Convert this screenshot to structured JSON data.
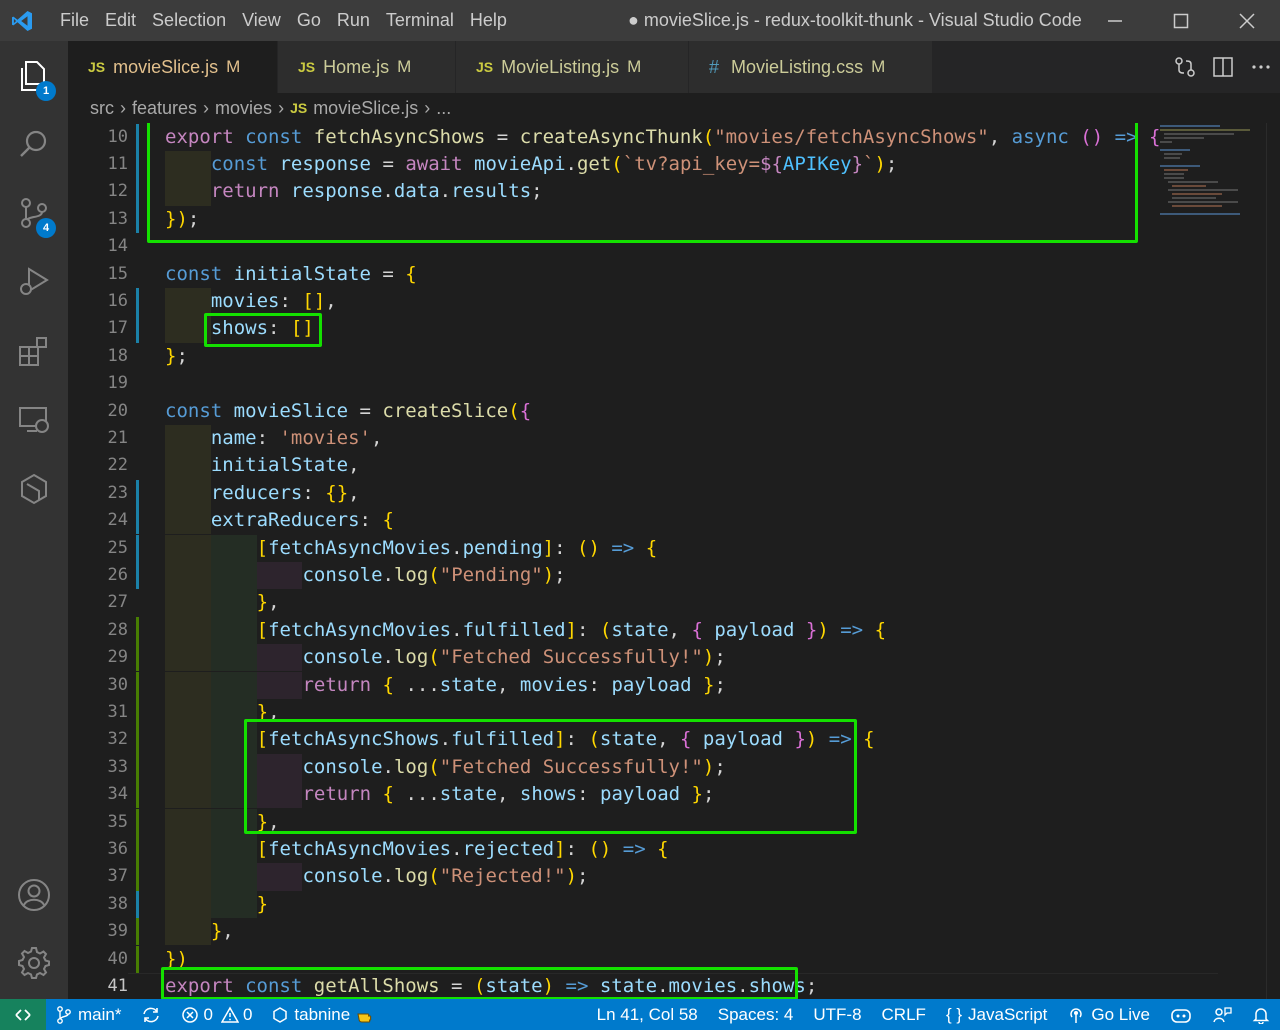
{
  "window": {
    "title": "● movieSlice.js - redux-toolkit-thunk - Visual Studio Code"
  },
  "menu": [
    "File",
    "Edit",
    "Selection",
    "View",
    "Go",
    "Run",
    "Terminal",
    "Help"
  ],
  "activitybar": {
    "explorer_badge": "1",
    "scm_badge": "4",
    "icons": [
      "explorer-icon",
      "search-icon",
      "source-control-icon",
      "run-debug-icon",
      "extensions-icon",
      "remote-explorer-icon",
      "packages-icon",
      "account-icon",
      "settings-gear-icon"
    ]
  },
  "tabs": [
    {
      "icon": "JS",
      "label": "movieSlice.js",
      "status": "M",
      "active": true,
      "dirty": true
    },
    {
      "icon": "JS",
      "label": "Home.js",
      "status": "M",
      "active": false
    },
    {
      "icon": "JS",
      "label": "MovieListing.js",
      "status": "M",
      "active": false
    },
    {
      "icon": "#",
      "label": "MovieListing.css",
      "status": "M",
      "active": false
    }
  ],
  "breadcrumb": {
    "parts": [
      "src",
      "features",
      "movies"
    ],
    "file_icon": "JS",
    "file": "movieSlice.js",
    "more": "..."
  },
  "editor": {
    "current_line": 41,
    "lines": [
      {
        "n": "10",
        "code": "export const fetchAsyncShows = createAsyncThunk(\"movies/fetchAsyncShows\", async () => {"
      },
      {
        "n": "11",
        "code": "    const response = await movieApi.get(`tv?api_key=${APIKey}`);"
      },
      {
        "n": "12",
        "code": "    return response.data.results;"
      },
      {
        "n": "13",
        "code": "});"
      },
      {
        "n": "14",
        "code": ""
      },
      {
        "n": "15",
        "code": "const initialState = {"
      },
      {
        "n": "16",
        "code": "    movies: [],"
      },
      {
        "n": "17",
        "code": "    shows: []"
      },
      {
        "n": "18",
        "code": "};"
      },
      {
        "n": "19",
        "code": ""
      },
      {
        "n": "20",
        "code": "const movieSlice = createSlice({"
      },
      {
        "n": "21",
        "code": "    name: 'movies',"
      },
      {
        "n": "22",
        "code": "    initialState,"
      },
      {
        "n": "23",
        "code": "    reducers: {},"
      },
      {
        "n": "24",
        "code": "    extraReducers: {"
      },
      {
        "n": "25",
        "code": "        [fetchAsyncMovies.pending]: () => {"
      },
      {
        "n": "26",
        "code": "            console.log(\"Pending\");"
      },
      {
        "n": "27",
        "code": "        },"
      },
      {
        "n": "28",
        "code": "        [fetchAsyncMovies.fulfilled]: (state, { payload }) => {"
      },
      {
        "n": "29",
        "code": "            console.log(\"Fetched Successfully!\");"
      },
      {
        "n": "30",
        "code": "            return { ...state, movies: payload };"
      },
      {
        "n": "31",
        "code": "        },"
      },
      {
        "n": "32",
        "code": "        [fetchAsyncShows.fulfilled]: (state, { payload }) => {"
      },
      {
        "n": "33",
        "code": "            console.log(\"Fetched Successfully!\");"
      },
      {
        "n": "34",
        "code": "            return { ...state, shows: payload };"
      },
      {
        "n": "35",
        "code": "        },"
      },
      {
        "n": "36",
        "code": "        [fetchAsyncMovies.rejected]: () => {"
      },
      {
        "n": "37",
        "code": "            console.log(\"Rejected!\");"
      },
      {
        "n": "38",
        "code": "        }"
      },
      {
        "n": "39",
        "code": "    },"
      },
      {
        "n": "40",
        "code": "})"
      },
      {
        "n": "41",
        "code": "export const getAllShows = (state) => state.movies.shows;"
      }
    ]
  },
  "statusbar": {
    "remote_icon": "remote-icon",
    "branch": "main*",
    "errors": "0",
    "warnings": "0",
    "tabnine": "tabnine",
    "position": "Ln 41, Col 58",
    "spaces": "Spaces: 4",
    "encoding": "UTF-8",
    "eol": "CRLF",
    "language": "JavaScript",
    "language_prefix": "{ }",
    "golive": "Go Live"
  },
  "colors": {
    "highlight_box": "#14e000",
    "statusbar": "#007acc",
    "remote": "#16825d"
  }
}
